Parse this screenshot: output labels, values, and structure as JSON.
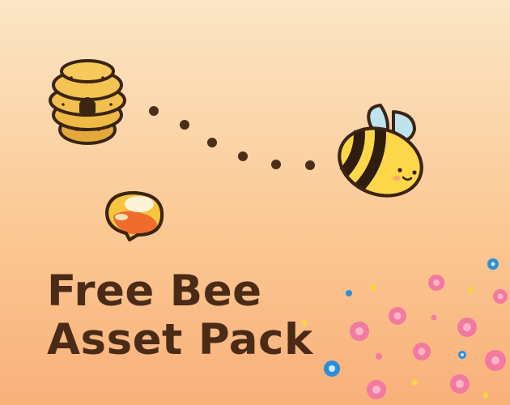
{
  "title": {
    "line1": "Free Bee",
    "line2": "Asset Pack"
  },
  "colors": {
    "bg_top": "#fbe6c6",
    "bg_bottom": "#f9b07a",
    "title": "#4a2b17",
    "outline": "#3a2414",
    "bee_yellow": "#fcd74a",
    "wing_blue": "#bfe3ee",
    "flower_pink": "#f27aa0",
    "flower_blue": "#2a8fd8",
    "dot_yellow": "#f7d24f"
  },
  "icons": [
    "beehive-icon",
    "bee-icon",
    "honey-drop-icon",
    "flight-path-dots",
    "flower-patch"
  ]
}
